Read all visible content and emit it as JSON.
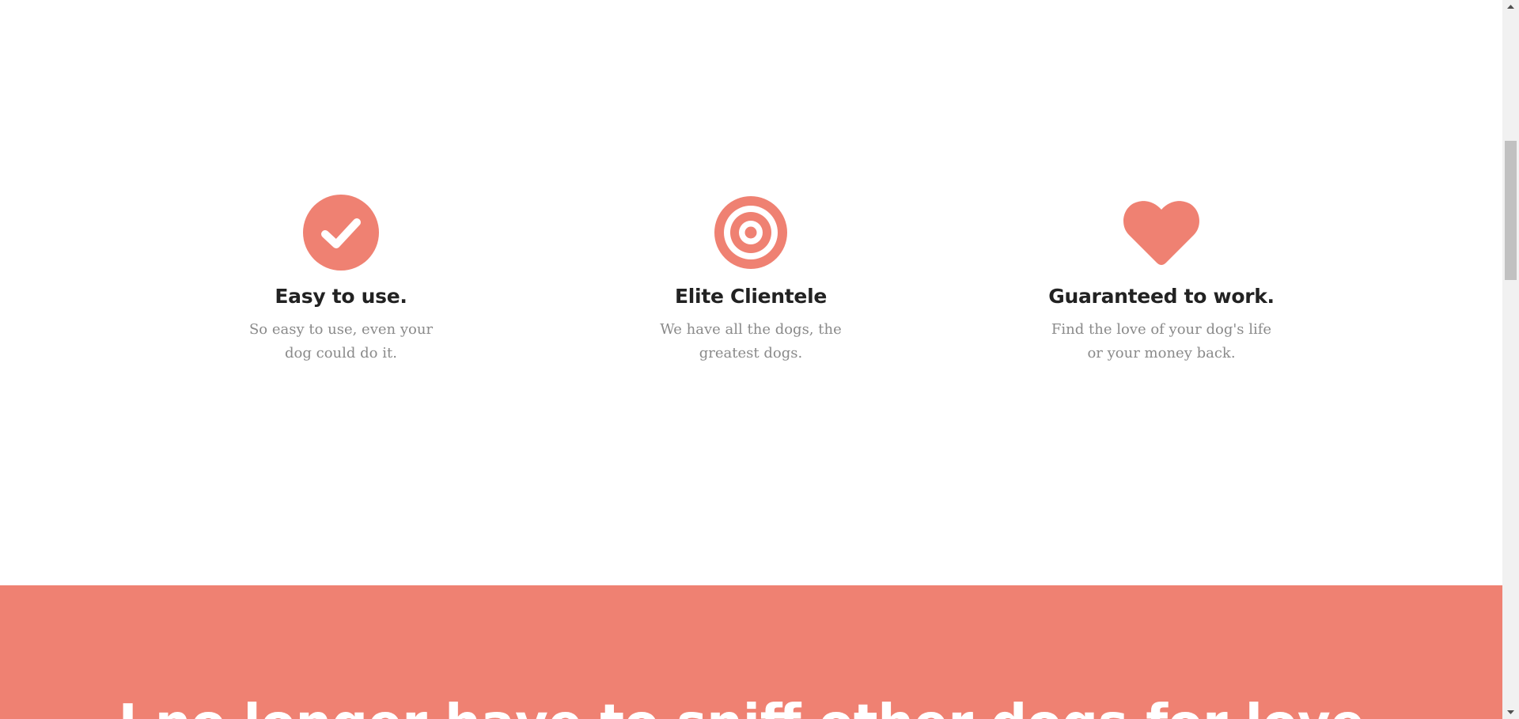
{
  "colors": {
    "accent": "#ef8172",
    "title": "#222222",
    "body_text": "#8a8a8a"
  },
  "features": [
    {
      "icon": "check-circle-icon",
      "title": "Easy to use.",
      "description": "So easy to use, even your dog could do it."
    },
    {
      "icon": "target-icon",
      "title": "Elite Clientele",
      "description": "We have all the dogs, the greatest dogs."
    },
    {
      "icon": "heart-icon",
      "title": "Guaranteed to work.",
      "description": "Find the love of your dog's life or your money back."
    }
  ],
  "testimonial": {
    "heading": "I no longer have to sniff other dogs for love."
  },
  "scrollbar": {
    "position_fraction": 0.22
  }
}
